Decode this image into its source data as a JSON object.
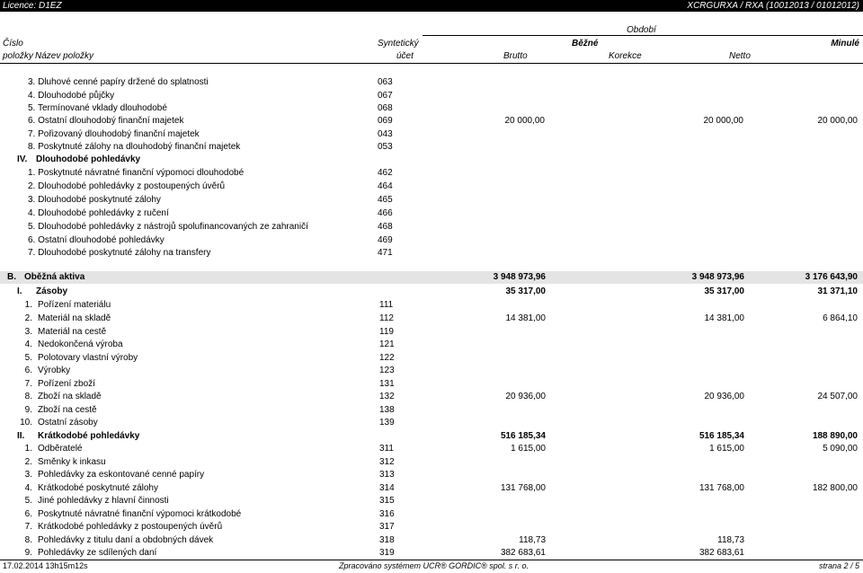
{
  "topbar": {
    "licence": "Licence: D1EZ",
    "code": "XCRGURXA / RXA  (10012013 / 01012012)"
  },
  "header": {
    "obdobi": "Období",
    "cislo": "Číslo",
    "polozky": "položky",
    "nazev": "Název položky",
    "syntetic": "Syntetický",
    "ucet": "účet",
    "bezne": "Běžné",
    "minule": "Minulé",
    "brutto": "Brutto",
    "korekce": "Korekce",
    "netto": "Netto"
  },
  "rows1": [
    {
      "label": "3.  Dluhové cenné papíry držené do splatnosti",
      "ucet": "063",
      "brutto": "",
      "netto": "",
      "minule": ""
    },
    {
      "label": "4.  Dlouhodobé půjčky",
      "ucet": "067",
      "brutto": "",
      "netto": "",
      "minule": ""
    },
    {
      "label": "5.  Termínované vklady dlouhodobé",
      "ucet": "068",
      "brutto": "",
      "netto": "",
      "minule": ""
    },
    {
      "label": "6.  Ostatní dlouhodobý finanční majetek",
      "ucet": "069",
      "brutto": "20 000,00",
      "netto": "20 000,00",
      "minule": "20 000,00"
    },
    {
      "label": "7.  Pořizovaný dlouhodobý finanční majetek",
      "ucet": "043",
      "brutto": "",
      "netto": "",
      "minule": ""
    },
    {
      "label": "8.  Poskytnuté zálohy na dlouhodobý finanční majetek",
      "ucet": "053",
      "brutto": "",
      "netto": "",
      "minule": ""
    }
  ],
  "sec_iv": {
    "num": "IV.",
    "label": "Dlouhodobé pohledávky"
  },
  "rows2": [
    {
      "label": "1.  Poskytnuté návratné finanční výpomoci dlouhodobé",
      "ucet": "462"
    },
    {
      "label": "2.  Dlouhodobé pohledávky z postoupených úvěrů",
      "ucet": "464"
    },
    {
      "label": "3.  Dlouhodobé poskytnuté zálohy",
      "ucet": "465"
    },
    {
      "label": "4.  Dlouhodobé pohledávky z ručení",
      "ucet": "466"
    },
    {
      "label": "5.  Dlouhodobé pohledávky z nástrojů spolufinancovaných ze zahraničí",
      "ucet": "468"
    },
    {
      "label": "6.  Ostatní dlouhodobé pohledávky",
      "ucet": "469"
    },
    {
      "label": "7.  Dlouhodobé poskytnuté zálohy na transfery",
      "ucet": "471"
    }
  ],
  "sec_b": {
    "num": "B.",
    "label": "Oběžná aktiva",
    "brutto": "3 948 973,96",
    "netto": "3 948 973,96",
    "minule": "3 176 643,90"
  },
  "sec_i": {
    "num": "I.",
    "label": "Zásoby",
    "brutto": "35 317,00",
    "netto": "35 317,00",
    "minule": "31 371,10"
  },
  "rows3": [
    {
      "n": "1.",
      "label": "Pořízení materiálu",
      "ucet": "111",
      "brutto": "",
      "netto": "",
      "minule": ""
    },
    {
      "n": "2.",
      "label": "Materiál na skladě",
      "ucet": "112",
      "brutto": "14 381,00",
      "netto": "14 381,00",
      "minule": "6 864,10"
    },
    {
      "n": "3.",
      "label": "Materiál na cestě",
      "ucet": "119",
      "brutto": "",
      "netto": "",
      "minule": ""
    },
    {
      "n": "4.",
      "label": "Nedokončená výroba",
      "ucet": "121",
      "brutto": "",
      "netto": "",
      "minule": ""
    },
    {
      "n": "5.",
      "label": "Polotovary vlastní výroby",
      "ucet": "122",
      "brutto": "",
      "netto": "",
      "minule": ""
    },
    {
      "n": "6.",
      "label": "Výrobky",
      "ucet": "123",
      "brutto": "",
      "netto": "",
      "minule": ""
    },
    {
      "n": "7.",
      "label": "Pořízení zboží",
      "ucet": "131",
      "brutto": "",
      "netto": "",
      "minule": ""
    },
    {
      "n": "8.",
      "label": "Zboží na skladě",
      "ucet": "132",
      "brutto": "20 936,00",
      "netto": "20 936,00",
      "minule": "24 507,00"
    },
    {
      "n": "9.",
      "label": "Zboží na cestě",
      "ucet": "138",
      "brutto": "",
      "netto": "",
      "minule": ""
    },
    {
      "n": "10.",
      "label": "Ostatní zásoby",
      "ucet": "139",
      "brutto": "",
      "netto": "",
      "minule": ""
    }
  ],
  "sec_ii": {
    "num": "II.",
    "label": "Krátkodobé pohledávky",
    "brutto": "516 185,34",
    "netto": "516 185,34",
    "minule": "188 890,00"
  },
  "rows4": [
    {
      "n": "1.",
      "label": "Odběratelé",
      "ucet": "311",
      "brutto": "1 615,00",
      "netto": "1 615,00",
      "minule": "5 090,00"
    },
    {
      "n": "2.",
      "label": "Směnky k inkasu",
      "ucet": "312",
      "brutto": "",
      "netto": "",
      "minule": ""
    },
    {
      "n": "3.",
      "label": "Pohledávky za eskontované cenné papíry",
      "ucet": "313",
      "brutto": "",
      "netto": "",
      "minule": ""
    },
    {
      "n": "4.",
      "label": "Krátkodobé poskytnuté zálohy",
      "ucet": "314",
      "brutto": "131 768,00",
      "netto": "131 768,00",
      "minule": "182 800,00"
    },
    {
      "n": "5.",
      "label": "Jiné pohledávky z hlavní činnosti",
      "ucet": "315",
      "brutto": "",
      "netto": "",
      "minule": ""
    },
    {
      "n": "6.",
      "label": "Poskytnuté návratné finanční výpomoci krátkodobé",
      "ucet": "316",
      "brutto": "",
      "netto": "",
      "minule": ""
    },
    {
      "n": "7.",
      "label": "Krátkodobé pohledávky z postoupených úvěrů",
      "ucet": "317",
      "brutto": "",
      "netto": "",
      "minule": ""
    },
    {
      "n": "8.",
      "label": "Pohledávky z titulu daní a obdobných dávek",
      "ucet": "318",
      "brutto": "118,73",
      "netto": "118,73",
      "minule": ""
    },
    {
      "n": "9.",
      "label": "Pohledávky ze sdílených daní",
      "ucet": "319",
      "brutto": "382 683,61",
      "netto": "382 683,61",
      "minule": ""
    }
  ],
  "footer": {
    "date": "17.02.2014 13h15m12s",
    "system": "Zpracováno systémem UCR® GORDIC® spol. s r. o.",
    "page": "strana 2 / 5"
  }
}
